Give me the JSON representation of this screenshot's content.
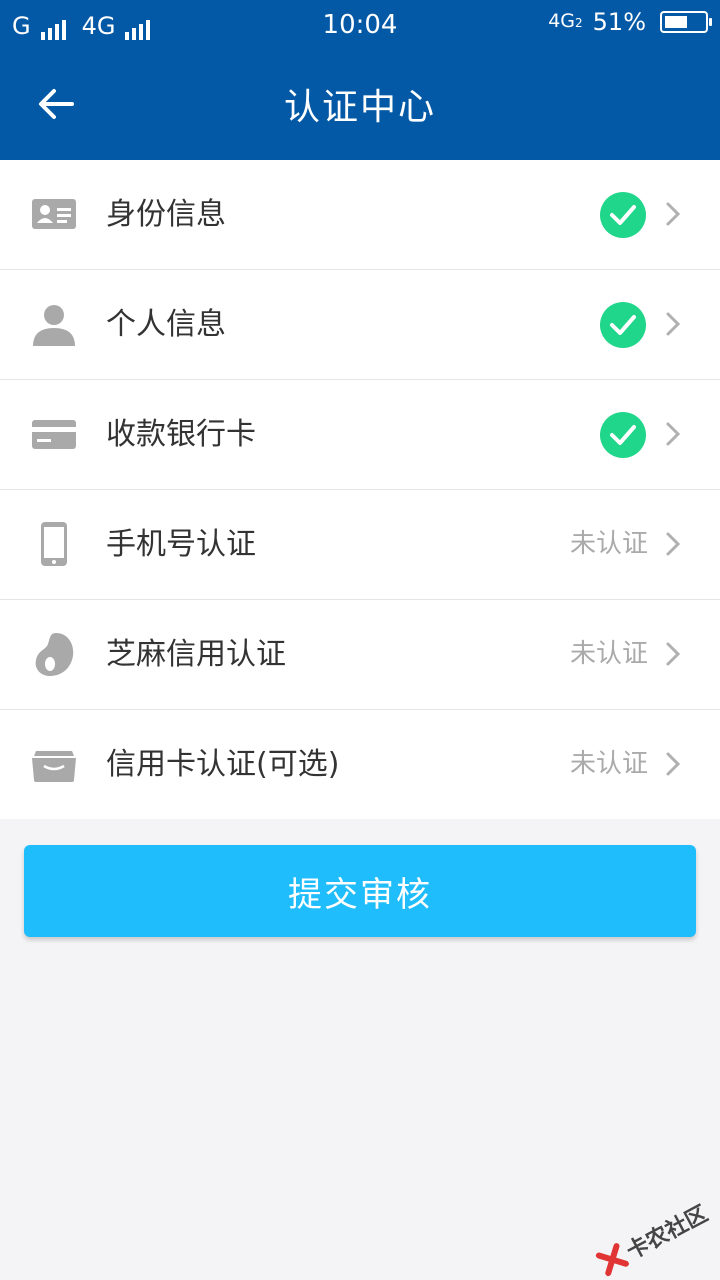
{
  "status_bar": {
    "carrier1": "G",
    "carrier2": "4G",
    "time": "10:04",
    "network": "4G",
    "network_sub": "2",
    "battery": "51%",
    "battery_level": 0.51
  },
  "header": {
    "title": "认证中心",
    "back_icon": "back-arrow-icon",
    "background": "#0459a6"
  },
  "items": [
    {
      "label": "身份信息",
      "icon": "id-card-icon",
      "verified": true,
      "status": ""
    },
    {
      "label": "个人信息",
      "icon": "person-icon",
      "verified": true,
      "status": ""
    },
    {
      "label": "收款银行卡",
      "icon": "bank-card-icon",
      "verified": true,
      "status": ""
    },
    {
      "label": "手机号认证",
      "icon": "phone-icon",
      "verified": false,
      "status": "未认证"
    },
    {
      "label": "芝麻信用认证",
      "icon": "sesame-credit-icon",
      "verified": false,
      "status": "未认证"
    },
    {
      "label": "信用卡认证(可选)",
      "icon": "credit-card-icon",
      "verified": false,
      "status": "未认证"
    }
  ],
  "submit_label": "提交审核",
  "colors": {
    "accent_button": "#1fbdfb",
    "check_green": "#1fd68a",
    "icon_gray": "#a9a9a9"
  },
  "watermark": "卡农社区"
}
